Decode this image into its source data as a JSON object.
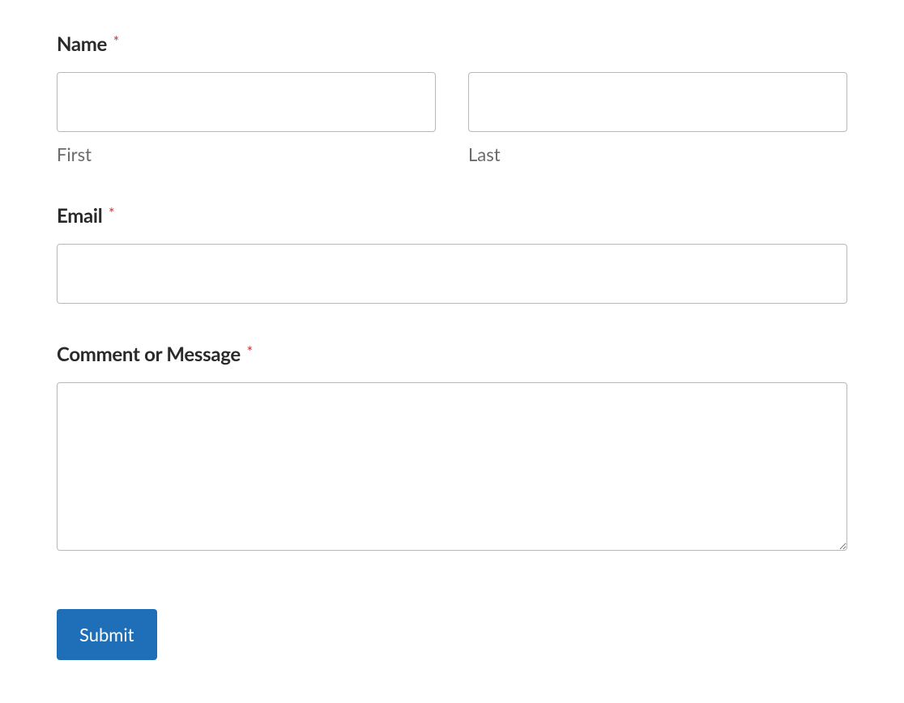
{
  "fields": {
    "name": {
      "label": "Name",
      "required_mark": "*",
      "first_sublabel": "First",
      "last_sublabel": "Last"
    },
    "email": {
      "label": "Email",
      "required_mark": "*"
    },
    "comment": {
      "label": "Comment or Message",
      "required_mark": "*"
    }
  },
  "submit": {
    "label": "Submit"
  }
}
